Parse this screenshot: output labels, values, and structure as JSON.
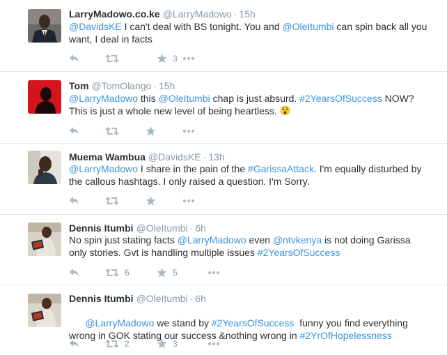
{
  "tweets": [
    {
      "fullname": "LarryMadowo.co.ke",
      "username": "@LarryMadowo",
      "time": "15h",
      "segments": [
        {
          "t": "@DavidsKE",
          "link": true
        },
        {
          "t": " I can't deal with BS tonight. You and ",
          "link": false
        },
        {
          "t": "@OleItumbi",
          "link": true
        },
        {
          "t": " can spin back all you want, I deal in facts",
          "link": false
        }
      ],
      "retweets": "",
      "favorites": "3",
      "avatar": "man-in-suit"
    },
    {
      "fullname": "Tom",
      "username": "@TomOlango",
      "time": "15h",
      "segments": [
        {
          "t": "@LarryMadowo",
          "link": true
        },
        {
          "t": " this ",
          "link": false
        },
        {
          "t": "@OleItumbi",
          "link": true
        },
        {
          "t": " chap is just absurd. ",
          "link": false
        },
        {
          "t": "#2YearsOfSuccess",
          "link": true
        },
        {
          "t": " NOW? This is just a whole new level of being heartless. ",
          "link": false
        }
      ],
      "emoji": "worried-face",
      "retweets": "",
      "favorites": "",
      "avatar": "red-silhouette"
    },
    {
      "fullname": "Muema Wambua",
      "username": "@DavidsKE",
      "time": "13h",
      "segments": [
        {
          "t": "@LarryMadowo",
          "link": true
        },
        {
          "t": " I share in the pain of the ",
          "link": false
        },
        {
          "t": "#GarissaAttack",
          "link": true
        },
        {
          "t": ". I'm equally disturbed by the callous hashtags. I only raised a question. I'm Sorry.",
          "link": false
        }
      ],
      "retweets": "",
      "favorites": "",
      "avatar": "man-portrait"
    },
    {
      "fullname": "Dennis Itumbi",
      "username": "@OleItumbi",
      "time": "6h",
      "segments": [
        {
          "t": "No spin just stating facts ",
          "link": false
        },
        {
          "t": "@LarryMadowo",
          "link": true
        },
        {
          "t": " even ",
          "link": false
        },
        {
          "t": "@ntvkenya",
          "link": true
        },
        {
          "t": " is not doing Garissa only stories. Gvt is handling multiple issues ",
          "link": false
        },
        {
          "t": "#2YearsOfSuccess",
          "link": true
        }
      ],
      "retweets": "6",
      "favorites": "5",
      "avatar": "man-with-tablet"
    },
    {
      "fullname": "Dennis Itumbi",
      "username": "@OleItumbi",
      "time": "6h",
      "segments": [
        {
          "t": "@LarryMadowo",
          "link": true
        },
        {
          "t": " we stand by ",
          "link": false
        },
        {
          "t": "#2YearsOfSuccess",
          "link": true
        },
        {
          "t": "  funny you find everything wrong in GOK stating our success &nothing wrong in ",
          "link": false
        },
        {
          "t": "#2YrOfHopelessness",
          "link": true
        }
      ],
      "retweets": "2",
      "favorites": "3",
      "avatar": "man-with-tablet"
    }
  ],
  "colors": {
    "link": "#3b94d9",
    "name": "#292f33",
    "meta": "#8899a6",
    "icon": "#aab8c2",
    "divider": "#e1e8ed"
  }
}
